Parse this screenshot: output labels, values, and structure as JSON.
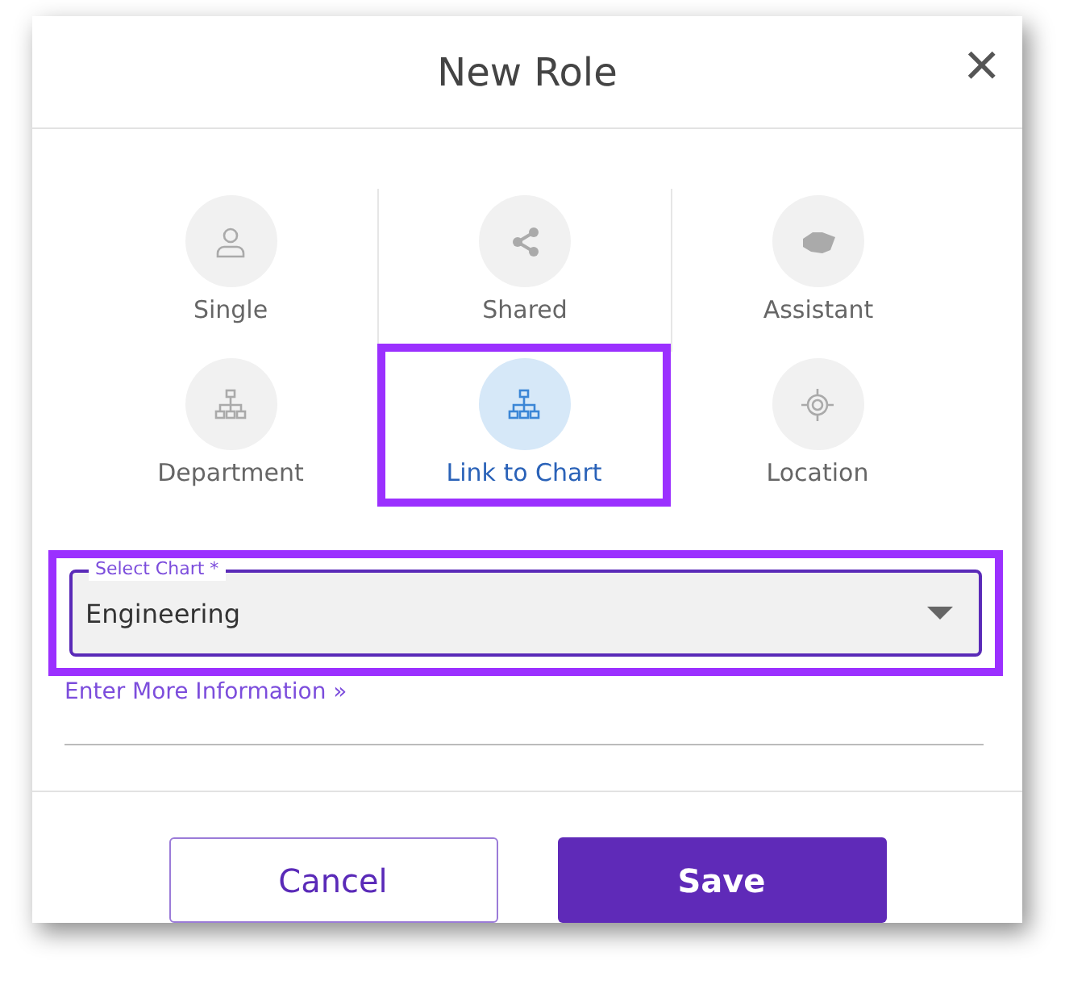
{
  "dialog": {
    "title": "New Role",
    "close": "×"
  },
  "role_types": [
    {
      "label": "Single",
      "selected": false
    },
    {
      "label": "Shared",
      "selected": false
    },
    {
      "label": "Assistant",
      "selected": false
    },
    {
      "label": "Department",
      "selected": false
    },
    {
      "label": "Link to Chart",
      "selected": true
    },
    {
      "label": "Location",
      "selected": false
    }
  ],
  "select_chart": {
    "label": "Select Chart *",
    "value": "Engineering",
    "highlighted": true
  },
  "more_info_link": "Enter More Information »",
  "buttons": [
    {
      "label": "Cancel",
      "kind": "secondary"
    },
    {
      "label": "Save",
      "kind": "primary"
    }
  ]
}
